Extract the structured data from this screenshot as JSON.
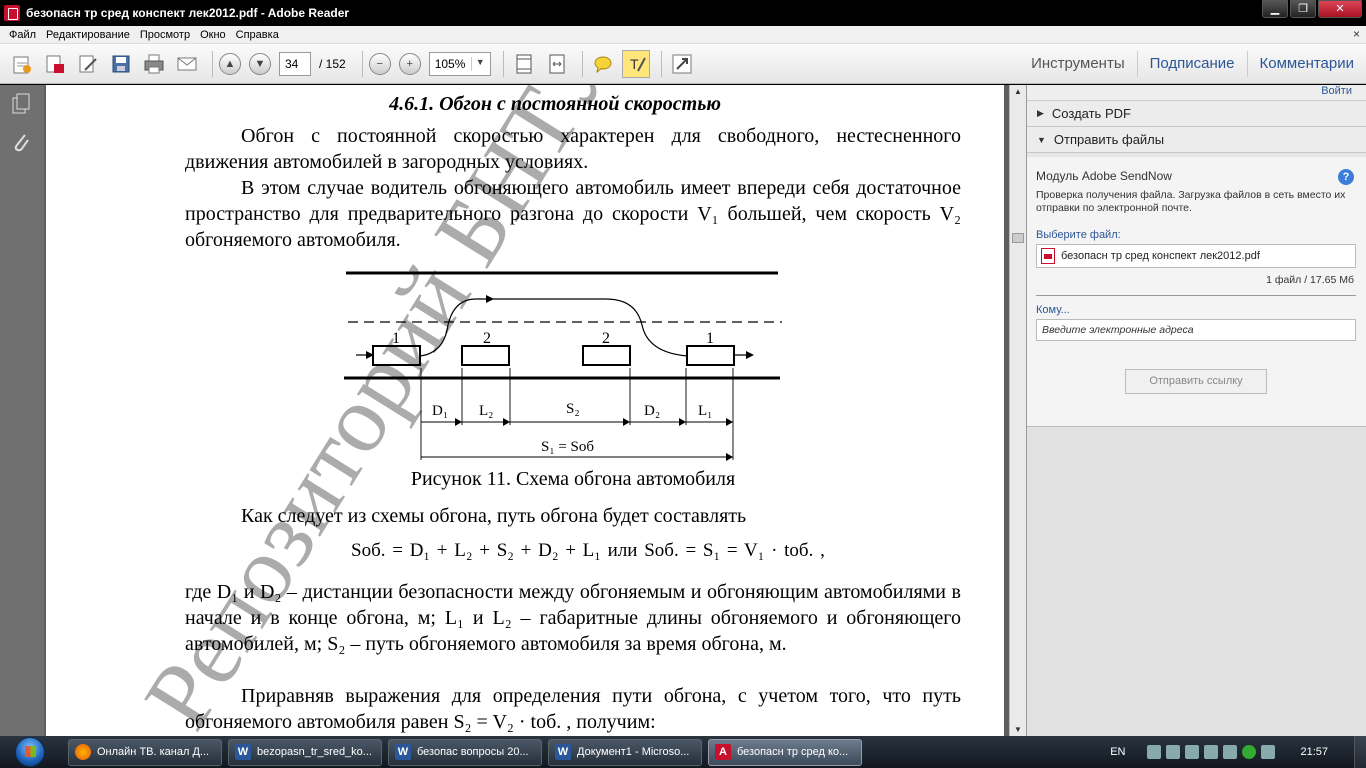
{
  "window": {
    "title": "безопасн тр сред конспект лек2012.pdf - Adobe Reader",
    "buttons": {
      "minimize": "▁",
      "maximize": "❐",
      "close": "✕"
    }
  },
  "menu": {
    "items": [
      "Файл",
      "Редактирование",
      "Просмотр",
      "Окно",
      "Справка"
    ],
    "close": "×"
  },
  "toolbar": {
    "page_current": "34",
    "page_total": "/ 152",
    "zoom": "105%",
    "zoom_dropdown": "▼",
    "tools_label": "Инструменты",
    "sign_label": "Подписание",
    "comment_label": "Комментарии"
  },
  "document": {
    "heading": "4.6.1. Обгон с постоянной скоростью",
    "p1": "Обгон с постоянной скоростью характерен для свободного, нестесненного движения автомобилей в загородных условиях.",
    "p2": "В этом случае водитель обгоняющего автомобиль имеет впереди себя достаточное пространство для предварительного разгона до скорости V₁ большей, чем скорость V₂ обгоняемого автомобиля.",
    "figure": {
      "cars": [
        "1",
        "2",
        "2",
        "1"
      ],
      "dims": [
        "D₁",
        "L₂",
        "S₂",
        "D₂",
        "L₁"
      ],
      "total": "S₁ = Sоб"
    },
    "caption": "Рисунок 11. Схема обгона автомобиля",
    "p3": "Как следует из схемы обгона, путь обгона будет составлять",
    "formula": "Sоб. = D₁ + L₂ + S₂ + D₂ + L₁    или    Sоб. = S₁ = V₁ · tоб. ,",
    "p4": "где D₁ и D₂ – дистанции безопасности между обгоняемым и обгоняющим автомобилями в начале и в конце обгона, м; L₁ и L₂ – габаритные длины обгоняемого и обгоняющего автомобилей, м; S₂ – путь обгоняемого автомобиля за время обгона, м.",
    "p5": "Приравняв выражения для определения пути обгона, с учетом того, что путь обгоняемого автомобиля равен S₂ = V₂ · tоб. , получим:",
    "watermark": "Репозиторий БНТУ"
  },
  "right_panel": {
    "login": "Войти",
    "create_pdf": "Создать PDF",
    "send_files": "Отправить файлы",
    "module_title": "Модуль Adobe SendNow",
    "module_desc": "Проверка получения файла. Загрузка файлов в сеть вместо их отправки по электронной почте.",
    "choose_file_label": "Выберите файл:",
    "file_name": "безопасн тр сред конспект лек2012.pdf",
    "file_count": "1 файл / 17.65 Мб",
    "to_label": "Кому...",
    "to_placeholder": "Введите электронные адреса",
    "send_button": "Отправить ссылку",
    "help": "?"
  },
  "taskbar": {
    "tasks": [
      "Онлайн ТВ. канал Д...",
      "bezopasn_tr_sred_ko...",
      "безопас вопросы 20...",
      "Документ1 - Microso...",
      "безопасн тр сред ко..."
    ],
    "lang": "EN",
    "clock": "21:57"
  }
}
